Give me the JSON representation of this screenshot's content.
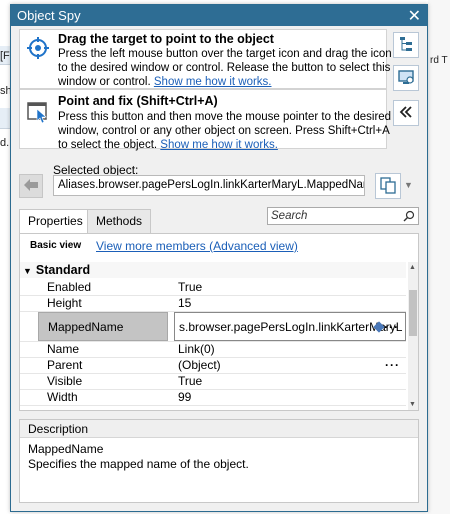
{
  "background": {
    "left_snips": [
      "[F",
      "sh",
      "d."
    ],
    "right_snip": "rd T"
  },
  "window": {
    "title": "Object Spy",
    "close_glyph": "✕"
  },
  "drag_tip": {
    "heading": "Drag the target to point to the object",
    "body": "Press the left mouse button over the target icon and drag the icon to the desired window or control. Release the button to select this window or control.",
    "link": "Show me how it works."
  },
  "fix_tip": {
    "heading": "Point and fix (Shift+Ctrl+A)",
    "body": "Press this button and then move the mouse pointer to the desired window, control or any other object on screen. Press Shift+Ctrl+A to select the object.",
    "link": "Show me how it works."
  },
  "selected": {
    "label": "Selected object:",
    "value": "Aliases.browser.pagePersLogIn.linkKarterMaryL.MappedName"
  },
  "tabs": [
    {
      "label": "Properties",
      "active": true
    },
    {
      "label": "Methods",
      "active": false
    }
  ],
  "search": {
    "placeholder": "Search"
  },
  "props": {
    "basic_view": "Basic view",
    "more_link": "View more members (Advanced view)",
    "group": "Standard",
    "rows": [
      {
        "name": "Enabled",
        "value": "True"
      },
      {
        "name": "Height",
        "value": "15"
      },
      {
        "name": "MappedName",
        "value": "s.browser.pagePersLogIn.linkKarterMaryL"
      },
      {
        "name": "Name",
        "value": "Link(0)"
      },
      {
        "name": "Parent",
        "value": "(Object)"
      },
      {
        "name": "Visible",
        "value": "True"
      },
      {
        "name": "Width",
        "value": "99"
      }
    ]
  },
  "description": {
    "header": "Description",
    "name": "MappedName",
    "text": "Specifies the mapped name of the object."
  },
  "colors": {
    "titlebar": "#2e6d94",
    "link": "#1b5fb8",
    "target_icon": "#1f73c9"
  }
}
